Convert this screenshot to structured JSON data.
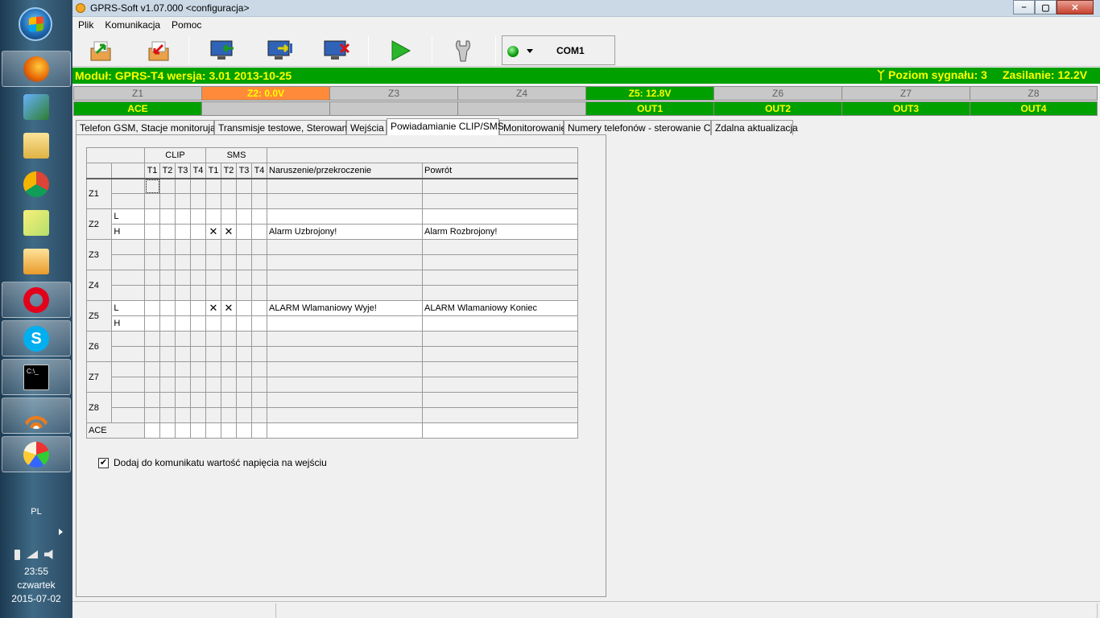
{
  "window": {
    "title": "GPRS-Soft v1.07.000   <configuracja>",
    "close": "✕",
    "maximize": "▢",
    "minimize": "–"
  },
  "menu": [
    "Plik",
    "Komunikacja",
    "Pomoc"
  ],
  "toolbar": {
    "port": "COM1",
    "status_color": "#00a000"
  },
  "module_bar": {
    "module": "Moduł: GPRS-T4 wersja: 3.01  2013-10-25",
    "signal": "Poziom sygnału: 3",
    "power": "Zasilanie: 12.2V"
  },
  "zones": {
    "headers": [
      "Z1",
      "Z2: 0.0V",
      "Z3",
      "Z4",
      "Z5: 12.8V",
      "Z6",
      "Z7",
      "Z8"
    ],
    "values": [
      "ACE",
      "",
      "",
      "",
      "OUT1",
      "OUT2",
      "OUT3",
      "OUT4"
    ]
  },
  "tabs": [
    "Telefon GSM, Stacje monitorujące",
    "Transmisje testowe,  Sterowanie",
    "Wejścia",
    "Powiadamianie CLIP/SMS",
    "Monitorowanie",
    "Numery telefonów - sterowanie CLIP",
    "Zdalna aktualizacja"
  ],
  "grid": {
    "group_clip": "CLIP",
    "group_sms": "SMS",
    "cols": [
      "T1",
      "T2",
      "T3",
      "T4",
      "T1",
      "T2",
      "T3",
      "T4"
    ],
    "col_violation": "Naruszenie/przekroczenie",
    "col_return": "Powrót",
    "zones": [
      {
        "name": "Z1",
        "rows": [
          {
            "lh": "",
            "marks": [
              0,
              0,
              0,
              0,
              0,
              0,
              0,
              0
            ],
            "v": "",
            "r": ""
          },
          {
            "lh": "",
            "marks": [
              0,
              0,
              0,
              0,
              0,
              0,
              0,
              0
            ],
            "v": "",
            "r": ""
          }
        ],
        "enabled": false
      },
      {
        "name": "Z2",
        "rows": [
          {
            "lh": "L",
            "marks": [
              0,
              0,
              0,
              0,
              0,
              0,
              0,
              0
            ],
            "v": "",
            "r": ""
          },
          {
            "lh": "H",
            "marks": [
              0,
              0,
              0,
              0,
              1,
              1,
              0,
              0
            ],
            "v": "Alarm Uzbrojony!",
            "r": "Alarm Rozbrojony!"
          }
        ],
        "enabled": true
      },
      {
        "name": "Z3",
        "rows": [
          {
            "lh": "",
            "marks": [
              0,
              0,
              0,
              0,
              0,
              0,
              0,
              0
            ],
            "v": "",
            "r": ""
          },
          {
            "lh": "",
            "marks": [
              0,
              0,
              0,
              0,
              0,
              0,
              0,
              0
            ],
            "v": "",
            "r": ""
          }
        ],
        "enabled": false
      },
      {
        "name": "Z4",
        "rows": [
          {
            "lh": "",
            "marks": [
              0,
              0,
              0,
              0,
              0,
              0,
              0,
              0
            ],
            "v": "",
            "r": ""
          },
          {
            "lh": "",
            "marks": [
              0,
              0,
              0,
              0,
              0,
              0,
              0,
              0
            ],
            "v": "",
            "r": ""
          }
        ],
        "enabled": false
      },
      {
        "name": "Z5",
        "rows": [
          {
            "lh": "L",
            "marks": [
              0,
              0,
              0,
              0,
              1,
              1,
              0,
              0
            ],
            "v": "ALARM Wlamaniowy Wyje!",
            "r": "ALARM Wlamaniowy Koniec"
          },
          {
            "lh": "H",
            "marks": [
              0,
              0,
              0,
              0,
              0,
              0,
              0,
              0
            ],
            "v": "",
            "r": ""
          }
        ],
        "enabled": true
      },
      {
        "name": "Z6",
        "rows": [
          {
            "lh": "",
            "marks": [
              0,
              0,
              0,
              0,
              0,
              0,
              0,
              0
            ],
            "v": "",
            "r": ""
          },
          {
            "lh": "",
            "marks": [
              0,
              0,
              0,
              0,
              0,
              0,
              0,
              0
            ],
            "v": "",
            "r": ""
          }
        ],
        "enabled": false
      },
      {
        "name": "Z7",
        "rows": [
          {
            "lh": "",
            "marks": [
              0,
              0,
              0,
              0,
              0,
              0,
              0,
              0
            ],
            "v": "",
            "r": ""
          },
          {
            "lh": "",
            "marks": [
              0,
              0,
              0,
              0,
              0,
              0,
              0,
              0
            ],
            "v": "",
            "r": ""
          }
        ],
        "enabled": false
      },
      {
        "name": "Z8",
        "rows": [
          {
            "lh": "",
            "marks": [
              0,
              0,
              0,
              0,
              0,
              0,
              0,
              0
            ],
            "v": "",
            "r": ""
          },
          {
            "lh": "",
            "marks": [
              0,
              0,
              0,
              0,
              0,
              0,
              0,
              0
            ],
            "v": "",
            "r": ""
          }
        ],
        "enabled": false
      }
    ],
    "ace": "ACE",
    "mark": "✕"
  },
  "checkbox": {
    "label": "Dodaj do komunikatu wartość napięcia na wejściu",
    "checked": true,
    "mark": "✔"
  },
  "taskbar": {
    "lang": "PL",
    "time": "23:55",
    "day": "czwartek",
    "date": "2015-07-02"
  }
}
